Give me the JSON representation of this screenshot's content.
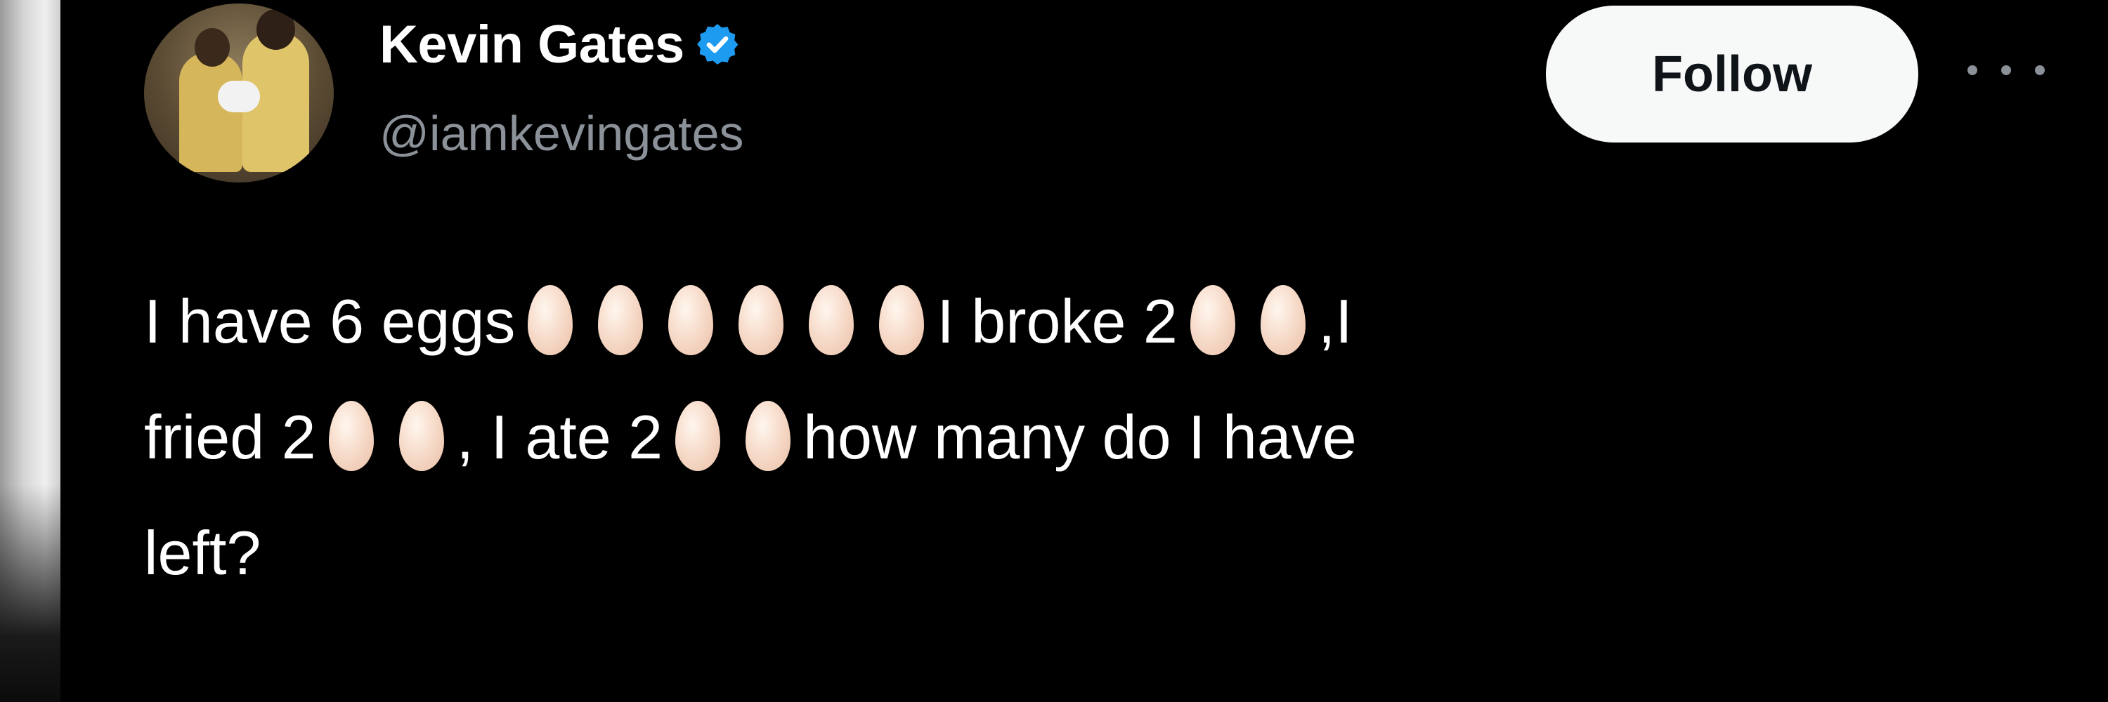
{
  "tweet": {
    "author": {
      "name": "Kevin Gates",
      "handle": "@iamkevingates",
      "verified": true
    },
    "follow_label": "Follow",
    "more_icon": "more-horizontal-icon",
    "text": {
      "seg1": "I have 6 eggs",
      "seg2": "I broke 2",
      "seg3": ",I",
      "seg4": "fried 2",
      "seg5": ", I ate 2",
      "seg6": "how many do I have",
      "seg7": "left?"
    },
    "timestamp": ""
  },
  "colors": {
    "background": "#000000",
    "text": "#ffffff",
    "muted": "#8b9198",
    "verified_badge": "#1d9bf0",
    "follow_button_bg": "#f7f9f9"
  }
}
